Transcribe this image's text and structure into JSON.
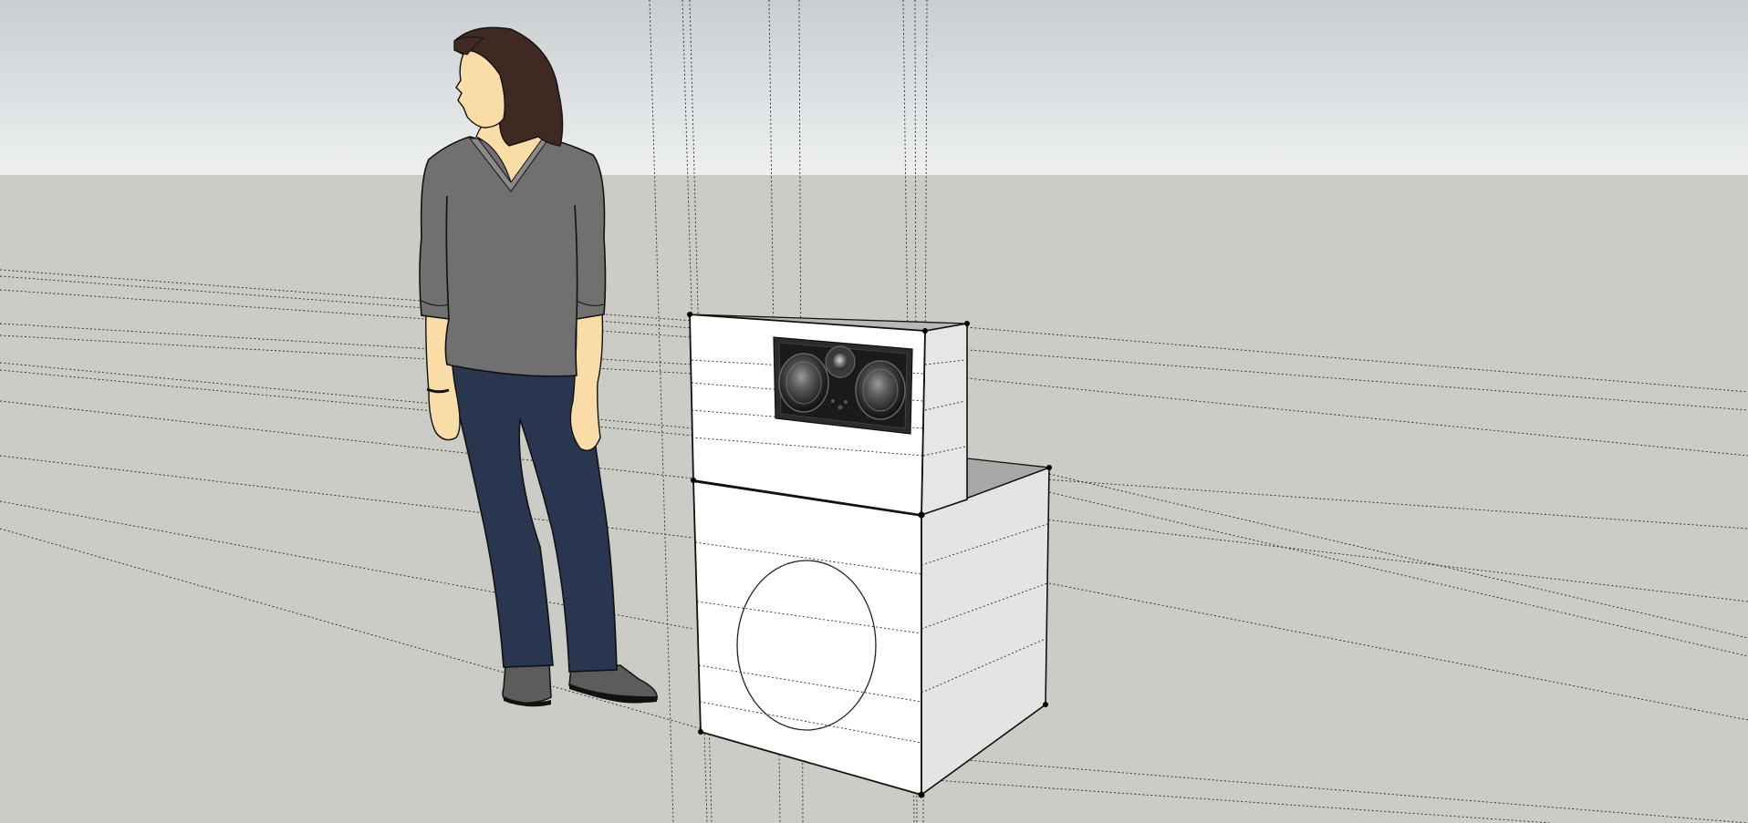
{
  "colors": {
    "sky_top": "#c9ced2",
    "sky_bottom": "#edf0f0",
    "ground": "#cbccc6",
    "cabinet_front": "#ffffff",
    "cabinet_side": "#e6e6e6",
    "cabinet_top": "#bdbdbd",
    "shirt": "#6f6f6f",
    "jeans": "#283650",
    "hair": "#3e2a22",
    "skin": "#f9dca6",
    "shoes": "#5a5a5a",
    "speaker_grille": "#2b2b2b"
  },
  "scene": {
    "figure": "person-figure",
    "upper_cabinet": "center-channel-speaker-cabinet",
    "lower_cabinet": "subwoofer-cabinet",
    "woofer": "subwoofer-driver-circle",
    "drivers": [
      "left-woofer",
      "tweeter",
      "right-woofer"
    ]
  }
}
